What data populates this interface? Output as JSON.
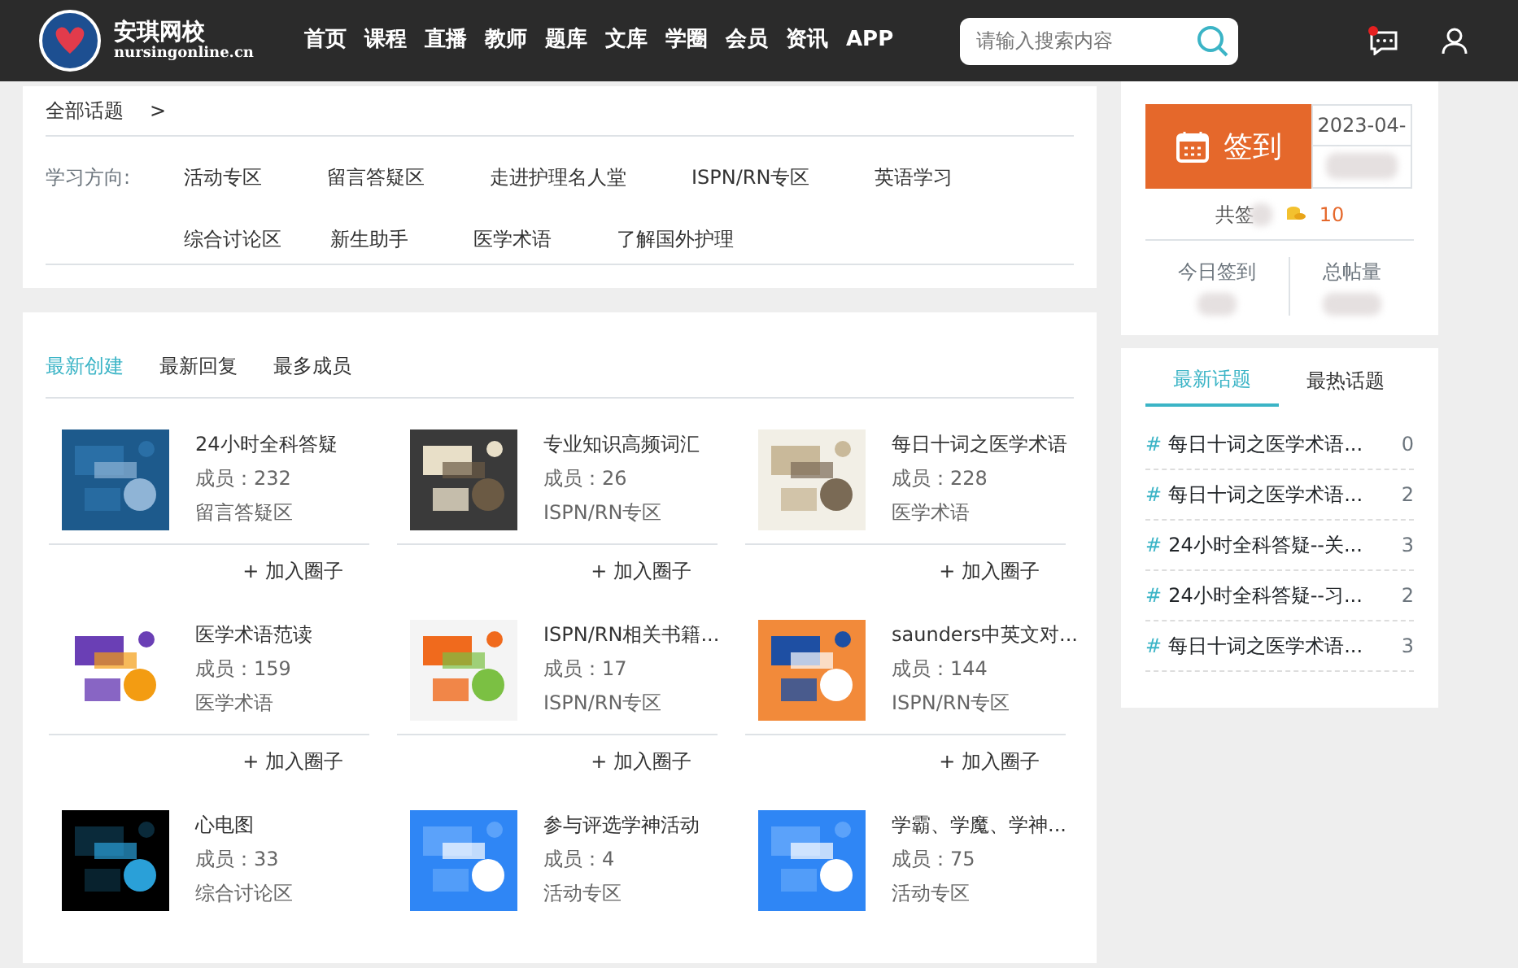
{
  "header": {
    "logo_title": "安琪网校",
    "logo_subtitle": "nursingonline.cn",
    "nav": [
      {
        "label": "首页"
      },
      {
        "label": "课程"
      },
      {
        "label": "直播"
      },
      {
        "label": "教师"
      },
      {
        "label": "题库"
      },
      {
        "label": "文库"
      },
      {
        "label": "学圈"
      },
      {
        "label": "会员"
      },
      {
        "label": "资讯"
      },
      {
        "label": "APP"
      }
    ],
    "search": {
      "placeholder": "请输入搜索内容"
    },
    "has_new_message": true
  },
  "breadcrumb": {
    "label": "全部话题",
    "separator": ">"
  },
  "filters": {
    "label": "学习方向:",
    "items": [
      "活动专区",
      "留言答疑区",
      "走进护理名人堂",
      "ISPN/RN专区",
      "英语学习",
      "综合讨论区",
      "新生助手",
      "医学术语",
      "了解国外护理"
    ]
  },
  "sort_tabs": [
    {
      "label": "最新创建",
      "selected": true
    },
    {
      "label": "最新回复",
      "selected": false
    },
    {
      "label": "最多成员",
      "selected": false
    }
  ],
  "groups": [
    {
      "title": "24小时全科答疑",
      "members": "成员：232",
      "category": "留言答疑区",
      "join": "+ 加入圈子"
    },
    {
      "title": "专业知识高频词汇",
      "members": "成员：26",
      "category": "ISPN/RN专区",
      "join": "+ 加入圈子"
    },
    {
      "title": "每日十词之医学术语",
      "members": "成员：228",
      "category": "医学术语",
      "join": "+ 加入圈子"
    },
    {
      "title": "医学术语范读",
      "members": "成员：159",
      "category": "医学术语",
      "join": "+ 加入圈子"
    },
    {
      "title": "ISPN/RN相关书籍...",
      "members": "成员：17",
      "category": "ISPN/RN专区",
      "join": "+ 加入圈子"
    },
    {
      "title": "saunders中英文对...",
      "members": "成员：144",
      "category": "ISPN/RN专区",
      "join": "+ 加入圈子"
    },
    {
      "title": "心电图",
      "members": "成员：33",
      "category": "综合讨论区"
    },
    {
      "title": "参与评选学神活动",
      "members": "成员：4",
      "category": "活动专区"
    },
    {
      "title": "学霸、学魔、学神...",
      "members": "成员：75",
      "category": "活动专区"
    }
  ],
  "signin": {
    "button": "签到",
    "date": "2023-04-",
    "total_label": "共签",
    "coins": "10",
    "today_label": "今日签到",
    "posts_label": "总帖量"
  },
  "topic_tabs": [
    {
      "label": "最新话题",
      "selected": true
    },
    {
      "label": "最热话题",
      "selected": false
    }
  ],
  "topics": [
    {
      "mark": "#",
      "title": "每日十词之医学术语...",
      "count": "0"
    },
    {
      "mark": "#",
      "title": "每日十词之医学术语...",
      "count": "2"
    },
    {
      "mark": "#",
      "title": "24小时全科答疑--关...",
      "count": "3"
    },
    {
      "mark": "#",
      "title": "24小时全科答疑--习...",
      "count": "2"
    },
    {
      "mark": "#",
      "title": "每日十词之医学术语...",
      "count": "3"
    }
  ]
}
